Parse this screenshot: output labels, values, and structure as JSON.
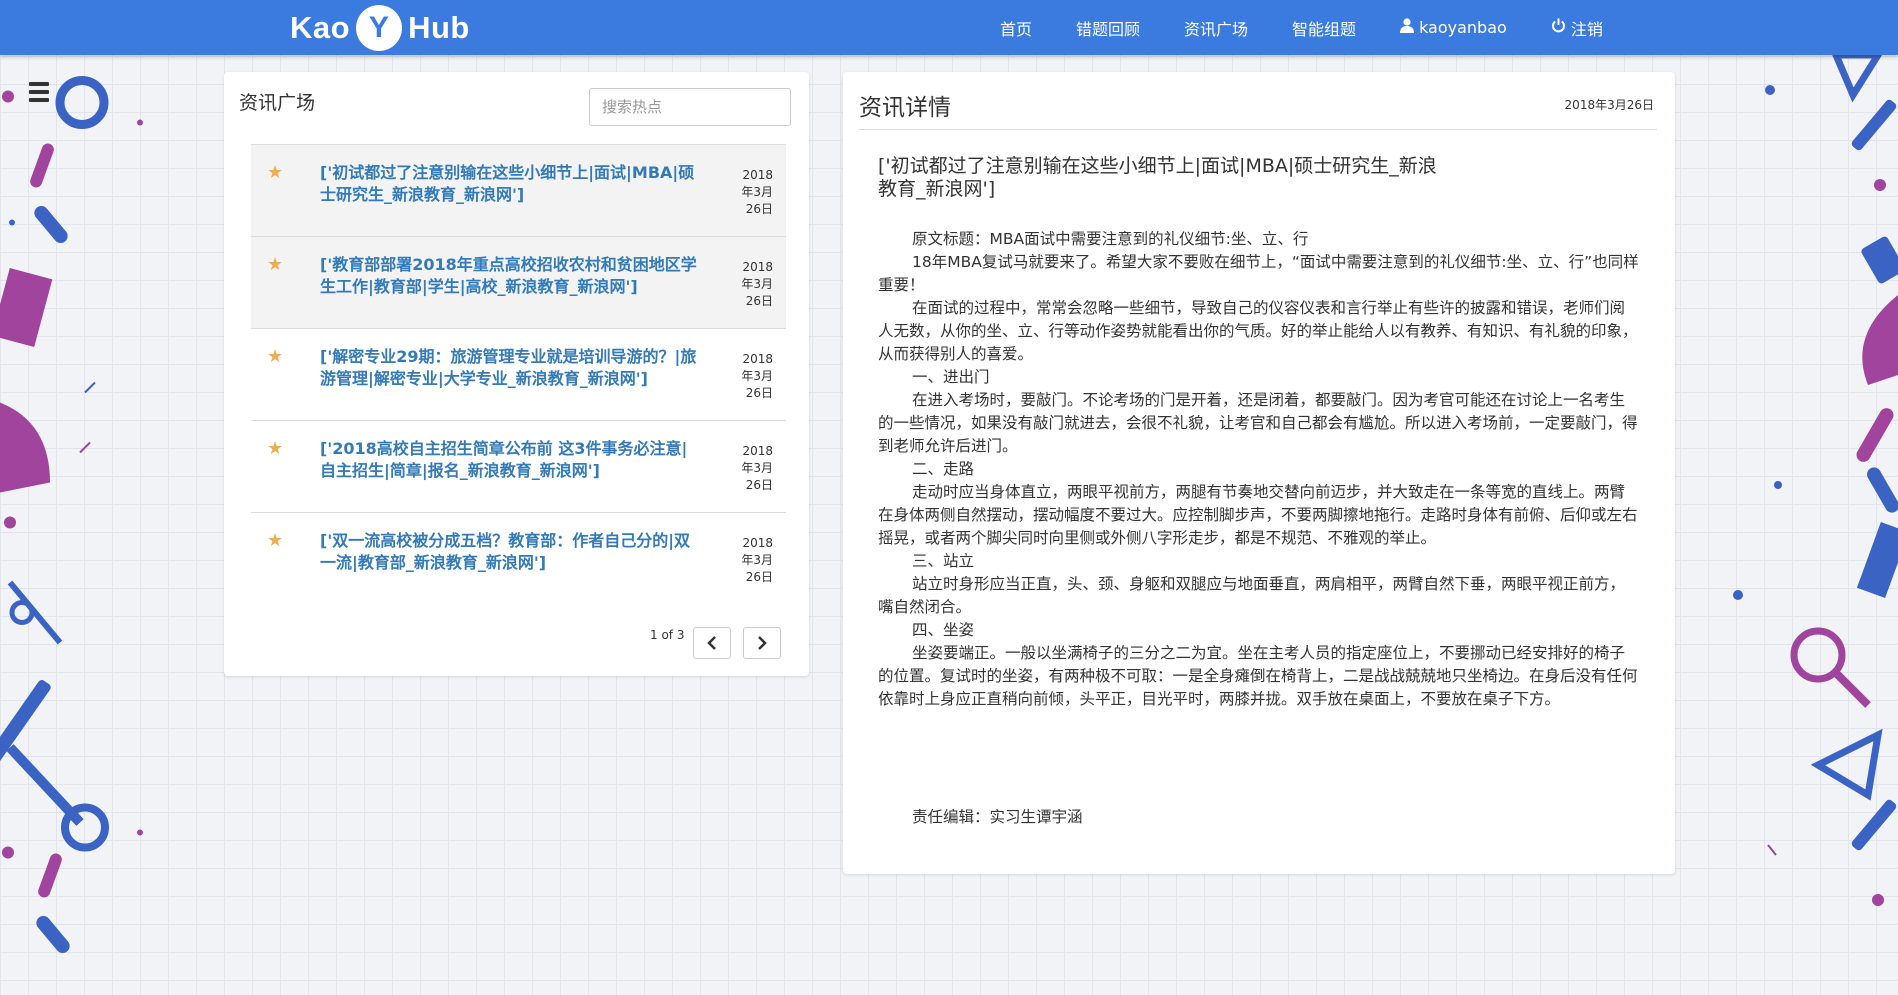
{
  "nav": {
    "brand_left": "Kao",
    "brand_logo": "Y",
    "brand_right": "Hub",
    "items": [
      {
        "label": "首页"
      },
      {
        "label": "错题回顾"
      },
      {
        "label": "资讯广场"
      },
      {
        "label": "智能组题"
      },
      {
        "label": "kaoyanbao",
        "icon": "user-icon"
      },
      {
        "label": "注销",
        "icon": "power-icon"
      }
    ]
  },
  "left_panel": {
    "title": "资讯广场",
    "search_placeholder": "搜索热点",
    "news": [
      {
        "title": "['初试都过了注意别输在这些小细节上|面试|MBA|硕士研究生_新浪教育_新浪网']",
        "date_year": "2018",
        "date_month": "年3月",
        "date_day": "26日"
      },
      {
        "title": "['教育部部署2018年重点高校招收农村和贫困地区学生工作|教育部|学生|高校_新浪教育_新浪网']",
        "date_year": "2018",
        "date_month": "年3月",
        "date_day": "26日"
      },
      {
        "title": "['解密专业29期：旅游管理专业就是培训导游的？|旅游管理|解密专业|大学专业_新浪教育_新浪网']",
        "date_year": "2018",
        "date_month": "年3月",
        "date_day": "26日"
      },
      {
        "title": "['2018高校自主招生简章公布前 这3件事务必注意|自主招生|简章|报名_新浪教育_新浪网']",
        "date_year": "2018",
        "date_month": "年3月",
        "date_day": "26日"
      },
      {
        "title": "['双一流高校被分成五档？教育部：作者自己分的|双一流|教育部_新浪教育_新浪网']",
        "date_year": "2018",
        "date_month": "年3月",
        "date_day": "26日"
      }
    ],
    "pager_text": "1 of 3"
  },
  "right_panel": {
    "title": "资讯详情",
    "date": "2018年3月26日",
    "article_title": "['初试都过了注意别输在这些小细节上|面试|MBA|硕士研究生_新浪教育_新浪网']",
    "paragraphs": [
      "原文标题：MBA面试中需要注意到的礼仪细节:坐、立、行",
      "18年MBA复试马就要来了。希望大家不要败在细节上，“面试中需要注意到的礼仪细节:坐、立、行”也同样重要！",
      "在面试的过程中，常常会忽略一些细节，导致自己的仪容仪表和言行举止有些许的披露和错误，老师们阅人无数，从你的坐、立、行等动作姿势就能看出你的气质。好的举止能给人以有教养、有知识、有礼貌的印象，从而获得别人的喜爱。",
      "一、进出门",
      "在进入考场时，要敲门。不论考场的门是开着，还是闭着，都要敲门。因为考官可能还在讨论上一名考生的一些情况，如果没有敲门就进去，会很不礼貌，让考官和自己都会有尴尬。所以进入考场前，一定要敲门，得到老师允许后进门。",
      "二、走路",
      "走动时应当身体直立，两眼平视前方，两腿有节奏地交替向前迈步，并大致走在一条等宽的直线上。两臂在身体两侧自然摆动，摆动幅度不要过大。应控制脚步声，不要两脚擦地拖行。走路时身体有前俯、后仰或左右摇晃，或者两个脚尖同时向里侧或外侧八字形走步，都是不规范、不雅观的举止。",
      "三、站立",
      "站立时身形应当正直，头、颈、身躯和双腿应与地面垂直，两肩相平，两臂自然下垂，两眼平视正前方，嘴自然闭合。",
      "四、坐姿",
      "坐姿要端正。一般以坐满椅子的三分之二为宜。坐在主考人员的指定座位上，不要挪动已经安排好的椅子的位置。复试时的坐姿，有两种极不可取：一是全身瘫倒在椅背上，二是战战兢兢地只坐椅边。在身后没有任何依靠时上身应正直稍向前倾，头平正，目光平时，两膝并拢。双手放在桌面上，不要放在桌子下方。"
    ],
    "editor": "责任编辑：实习生谭宇涵"
  },
  "colors": {
    "navbar": "#3b7be0",
    "link": "#337ab7",
    "star": "#f0ad4e",
    "deco_purple": "#a0449e",
    "deco_blue": "#3b63c4"
  }
}
